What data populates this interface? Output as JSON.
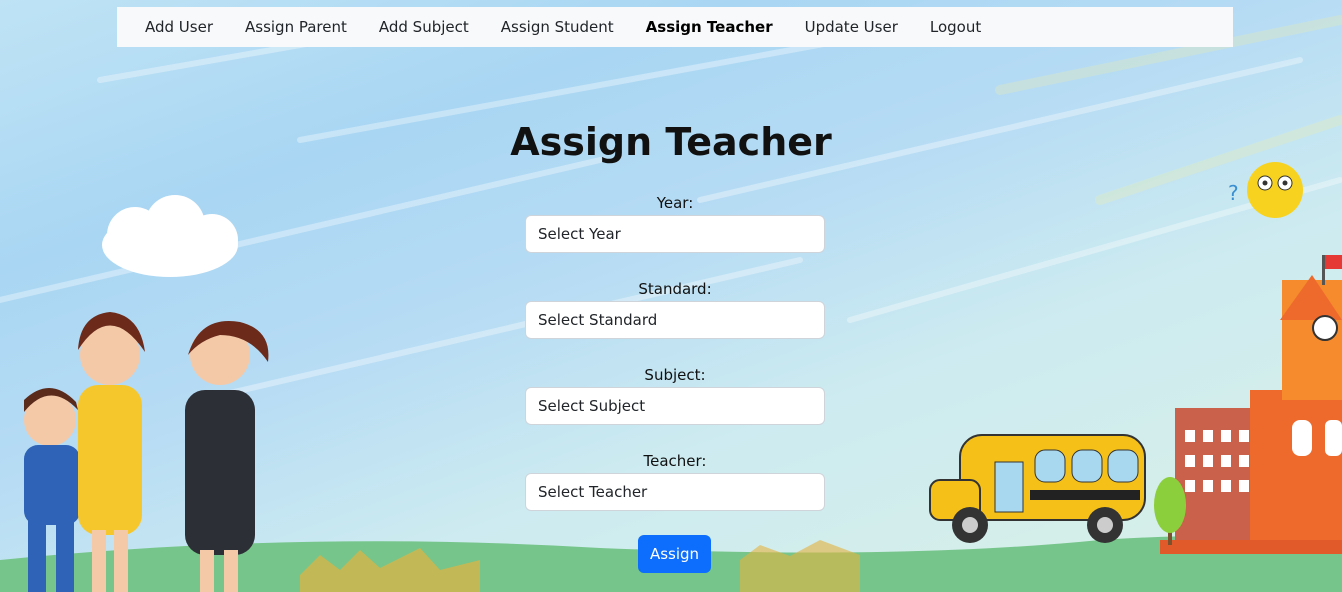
{
  "nav": {
    "items": [
      {
        "label": "Add User",
        "active": false
      },
      {
        "label": "Assign Parent",
        "active": false
      },
      {
        "label": "Add Subject",
        "active": false
      },
      {
        "label": "Assign Student",
        "active": false
      },
      {
        "label": "Assign Teacher",
        "active": true
      },
      {
        "label": "Update User",
        "active": false
      },
      {
        "label": "Logout",
        "active": false
      }
    ]
  },
  "form": {
    "title": "Assign Teacher",
    "fields": [
      {
        "label": "Year:",
        "value": "Select Year"
      },
      {
        "label": "Standard:",
        "value": "Select Standard"
      },
      {
        "label": "Subject:",
        "value": "Select Subject"
      },
      {
        "label": "Teacher:",
        "value": "Select Teacher"
      }
    ],
    "submit_label": "Assign"
  },
  "colors": {
    "primary": "#0d6efd",
    "navbar_bg": "#f8f9fa",
    "grass": "#76c58a"
  }
}
